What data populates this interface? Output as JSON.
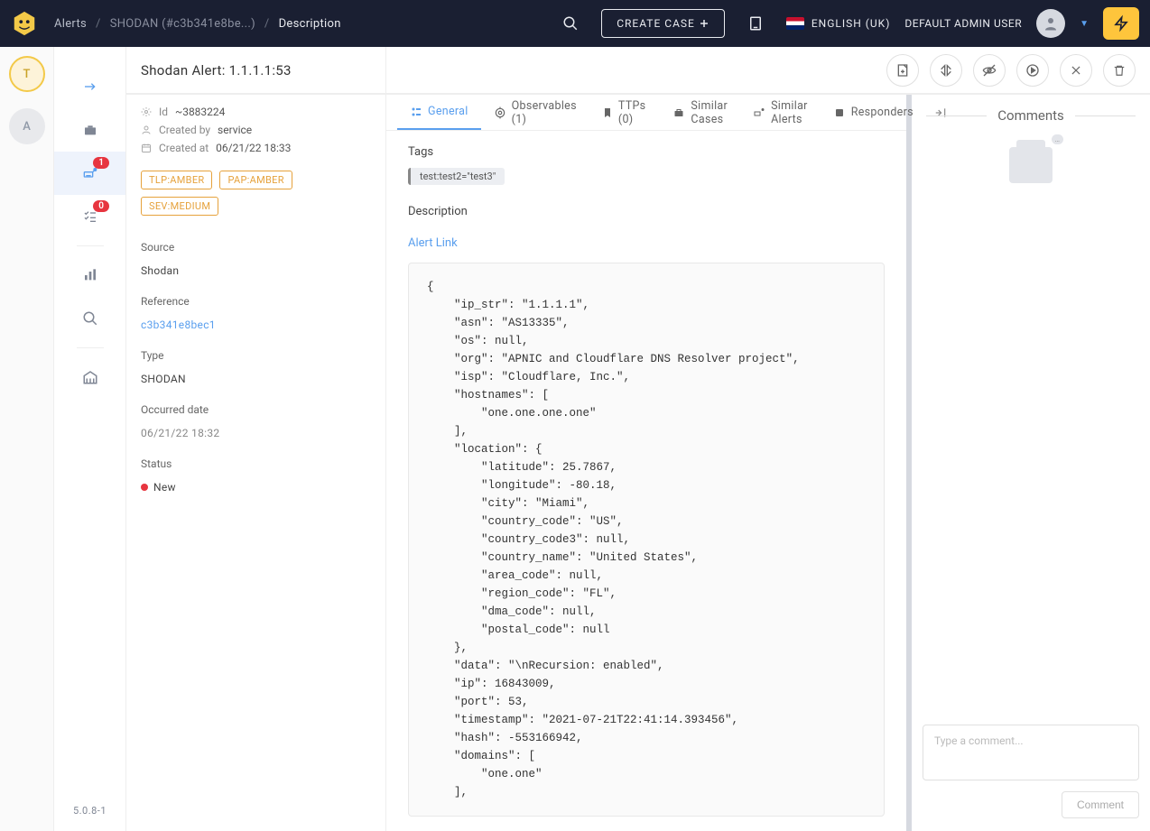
{
  "topbar": {
    "breadcrumb": {
      "root": "Alerts",
      "mid": "SHODAN (#c3b341e8be...)",
      "leaf": "Description"
    },
    "create_case": "CREATE CASE",
    "language": "ENGLISH (UK)",
    "user": "DEFAULT ADMIN USER"
  },
  "org_rail": {
    "t": "T",
    "a": "A"
  },
  "nav": {
    "alert_badge": "1",
    "tasks_badge": "0",
    "version": "5.0.8-1"
  },
  "alert": {
    "title": "Shodan Alert: 1.1.1.1:53",
    "id_label": "Id",
    "id_value": "~3883224",
    "createdby_label": "Created by",
    "createdby_value": "service",
    "createdat_label": "Created at",
    "createdat_value": "06/21/22 18:33",
    "tlp": "TLP:AMBER",
    "pap": "PAP:AMBER",
    "sev": "SEV:MEDIUM",
    "source_label": "Source",
    "source_value": "Shodan",
    "reference_label": "Reference",
    "reference_value": "c3b341e8bec1",
    "type_label": "Type",
    "type_value": "SHODAN",
    "occurred_label": "Occurred date",
    "occurred_value": "06/21/22 18:32",
    "status_label": "Status",
    "status_value": "New"
  },
  "tabs": {
    "general": "General",
    "observables": "Observables (1)",
    "ttps": "TTPs (0)",
    "similar_cases": "Similar Cases",
    "similar_alerts": "Similar Alerts",
    "responders": "Responders"
  },
  "content": {
    "tags_heading": "Tags",
    "tag1": "test:test2=\"test3\"",
    "desc_heading": "Description",
    "alert_link": "Alert Link",
    "code": "{\n    \"ip_str\": \"1.1.1.1\",\n    \"asn\": \"AS13335\",\n    \"os\": null,\n    \"org\": \"APNIC and Cloudflare DNS Resolver project\",\n    \"isp\": \"Cloudflare, Inc.\",\n    \"hostnames\": [\n        \"one.one.one.one\"\n    ],\n    \"location\": {\n        \"latitude\": 25.7867,\n        \"longitude\": -80.18,\n        \"city\": \"Miami\",\n        \"country_code\": \"US\",\n        \"country_code3\": null,\n        \"country_name\": \"United States\",\n        \"area_code\": null,\n        \"region_code\": \"FL\",\n        \"dma_code\": null,\n        \"postal_code\": null\n    },\n    \"data\": \"\\nRecursion: enabled\",\n    \"ip\": 16843009,\n    \"port\": 53,\n    \"timestamp\": \"2021-07-21T22:41:14.393456\",\n    \"hash\": -553166942,\n    \"domains\": [\n        \"one.one\"\n    ],"
  },
  "comments": {
    "title": "Comments",
    "placeholder": "Type a comment...",
    "button": "Comment"
  }
}
